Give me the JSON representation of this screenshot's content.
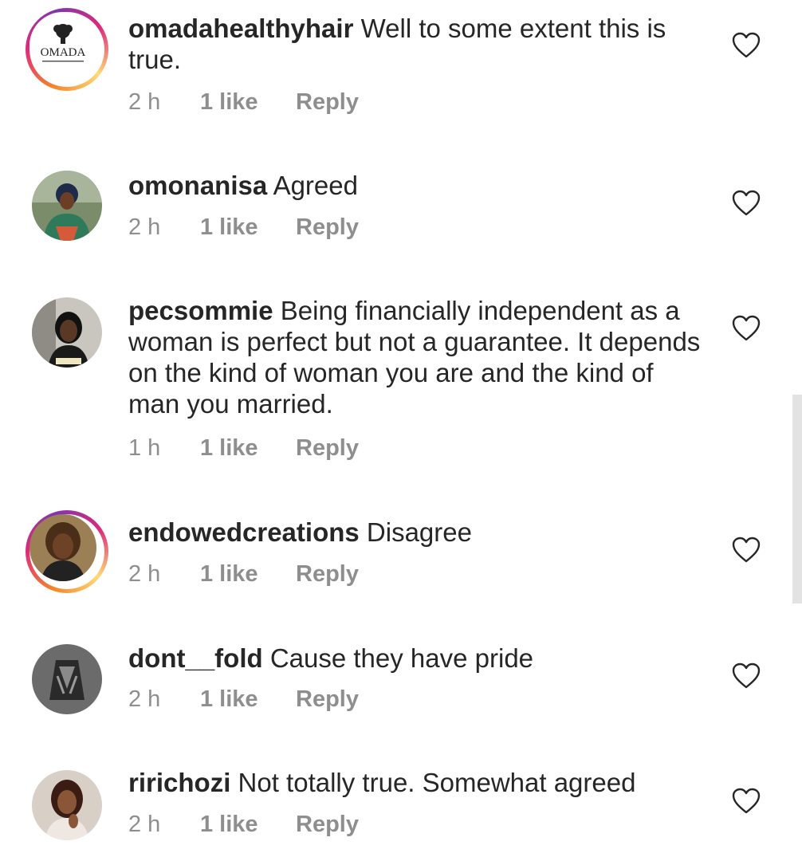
{
  "comments": [
    {
      "username": "omadahealthyhair",
      "text": "Well to some extent this is true.",
      "time": "2 h",
      "likes": "1 like",
      "reply": "Reply",
      "avatar_label": "OMADA",
      "story_ring": true
    },
    {
      "username": "omonanisa",
      "text": "Agreed",
      "time": "2 h",
      "likes": "1 like",
      "reply": "Reply",
      "story_ring": false
    },
    {
      "username": "pecsommie",
      "text": "Being financially independent as a woman is perfect but not a guarantee. It depends on the kind of woman you are and the kind of man you married.",
      "time": "1 h",
      "likes": "1 like",
      "reply": "Reply",
      "story_ring": false
    },
    {
      "username": "endowedcreations",
      "text": "Disagree",
      "time": "2 h",
      "likes": "1 like",
      "reply": "Reply",
      "story_ring": true
    },
    {
      "username": "dont__fold",
      "text": "Cause they have pride",
      "time": "2 h",
      "likes": "1 like",
      "reply": "Reply",
      "story_ring": false
    },
    {
      "username": "ririchozi",
      "text": "Not totally true. Somewhat agreed",
      "time": "2 h",
      "likes": "1 like",
      "reply": "Reply",
      "story_ring": false
    }
  ],
  "icons": {
    "like": "heart-outline-icon"
  },
  "colors": {
    "ring_start": "#f58529",
    "ring_mid": "#dd2a7b",
    "meta": "#8e8e8e",
    "text": "#262626"
  }
}
